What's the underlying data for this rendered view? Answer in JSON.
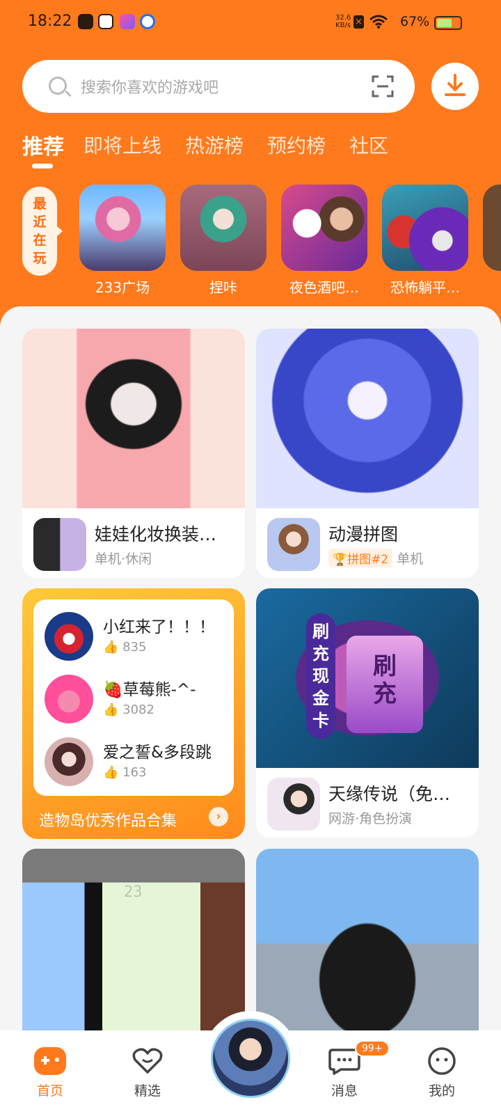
{
  "status_bar": {
    "time": "18:22",
    "net_speed_value": "32.6",
    "net_speed_unit": "KB/s",
    "battery_percent": "67%",
    "battery_level": 0.67,
    "notification_icons": [
      "douyin-app-icon",
      "paw-app-icon",
      "game-app-icon",
      "chat-app-icon"
    ],
    "icons": [
      "sim-blocked-icon",
      "wifi-icon",
      "battery-icon"
    ]
  },
  "search": {
    "placeholder": "搜索你喜欢的游戏吧",
    "scan_icon": "scan-icon",
    "download_icon": "download-icon"
  },
  "tabs": [
    {
      "label": "推荐",
      "active": true
    },
    {
      "label": "即将上线",
      "active": false
    },
    {
      "label": "热游榜",
      "active": false
    },
    {
      "label": "预约榜",
      "active": false
    },
    {
      "label": "社区",
      "active": false
    }
  ],
  "recent": {
    "label": "最近在玩",
    "items": [
      {
        "name": "233广场"
      },
      {
        "name": "捏咔"
      },
      {
        "name": "夜色酒吧…"
      },
      {
        "name": "恐怖躺平…"
      }
    ]
  },
  "feed": {
    "cards": [
      {
        "title": "娃娃化妆换装…",
        "subtitle": "单机·休闲"
      },
      {
        "title": "动漫拼图",
        "badge": "拼图#2",
        "badge_icon": "trophy-icon",
        "subtitle": "单机"
      },
      {
        "title": "天缘传说（免…",
        "subtitle": "网游·角色扮演",
        "banner_text": [
          "刷充现金卡",
          "刷充"
        ]
      }
    ],
    "works": {
      "items": [
        {
          "name": "小红来了！！！",
          "likes": "835"
        },
        {
          "name": "🍓草莓熊-^-",
          "likes": "3082"
        },
        {
          "name": "爱之誓&多段跳",
          "likes": "163"
        }
      ],
      "footer": "造物岛优秀作品合集",
      "pixel_counter": "23"
    }
  },
  "bottom_nav": {
    "items": [
      {
        "label": "首页",
        "active": true,
        "icon": "gamepad-icon"
      },
      {
        "label": "精选",
        "active": false,
        "icon": "heart-icon"
      },
      {
        "label": "消息",
        "active": false,
        "icon": "message-icon"
      },
      {
        "label": "我的",
        "active": false,
        "icon": "face-icon"
      }
    ],
    "unread_badge": "99+"
  },
  "colors": {
    "brand": "#ff7a1c",
    "background": "#f5f5f5"
  }
}
